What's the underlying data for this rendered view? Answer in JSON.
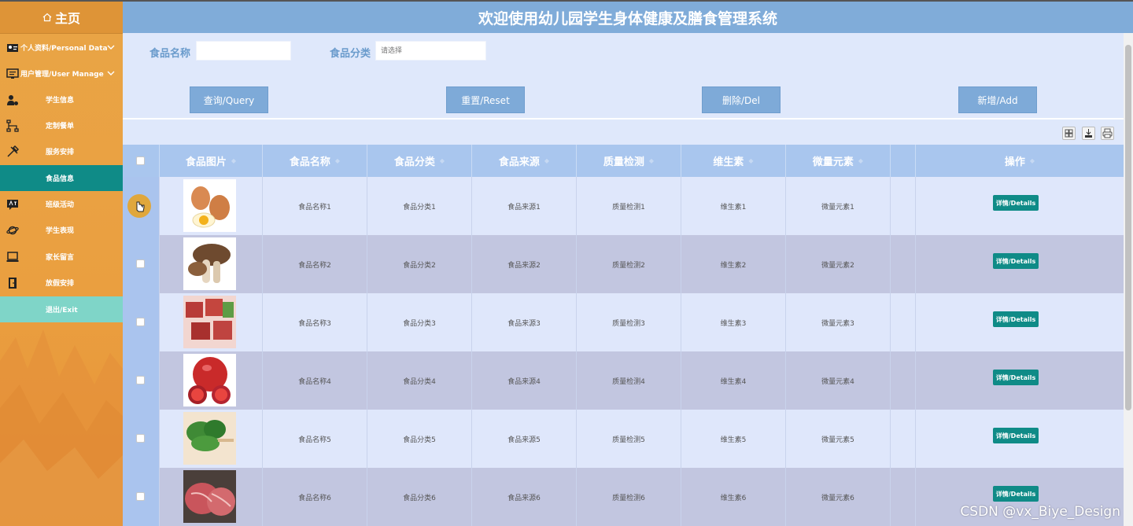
{
  "app": {
    "title": "欢迎使用幼儿园学生身体健康及膳食管理系统",
    "home": "主页"
  },
  "sidebar": {
    "items": [
      {
        "label": "个人资料/Personal Data",
        "icon": "id-card-icon",
        "expandable": true
      },
      {
        "label": "用户管理/User Manage",
        "icon": "monitor-icon",
        "expandable": true
      },
      {
        "label": "学生信息",
        "icon": "user-gear-icon"
      },
      {
        "label": "定制餐单",
        "icon": "sitemap-icon"
      },
      {
        "label": "服务安排",
        "icon": "tools-icon"
      },
      {
        "label": "食品信息",
        "icon": "",
        "active": true
      },
      {
        "label": "班级活动",
        "icon": "translate-icon"
      },
      {
        "label": "学生表现",
        "icon": "planet-icon"
      },
      {
        "label": "家长留言",
        "icon": "laptop-icon"
      },
      {
        "label": "放假安排",
        "icon": "door-icon"
      },
      {
        "label": "退出/Exit",
        "icon": ""
      }
    ]
  },
  "search": {
    "name_label": "食品名称",
    "name_value": "",
    "category_label": "食品分类",
    "category_placeholder": "请选择"
  },
  "buttons": {
    "query": "查询/Query",
    "reset": "重置/Reset",
    "delete": "删除/Del",
    "add": "新增/Add"
  },
  "table": {
    "headers": [
      "食品图片",
      "食品名称",
      "食品分类",
      "食品来源",
      "质量检测",
      "维生素",
      "微量元素",
      "操作"
    ],
    "rows": [
      {
        "image": "eggs",
        "name": "食品名称1",
        "category": "食品分类1",
        "source": "食品来源1",
        "quality": "质量检测1",
        "vitamin": "维生素1",
        "trace": "微量元素1"
      },
      {
        "image": "mushrooms",
        "name": "食品名称2",
        "category": "食品分类2",
        "source": "食品来源2",
        "quality": "质量检测2",
        "vitamin": "维生素2",
        "trace": "微量元素2"
      },
      {
        "image": "beef-cubes",
        "name": "食品名称3",
        "category": "食品分类3",
        "source": "食品来源3",
        "quality": "质量检测3",
        "vitamin": "维生素3",
        "trace": "微量元素3"
      },
      {
        "image": "pomegranate",
        "name": "食品名称4",
        "category": "食品分类4",
        "source": "食品来源4",
        "quality": "质量检测4",
        "vitamin": "维生素4",
        "trace": "微量元素4"
      },
      {
        "image": "spinach",
        "name": "食品名称5",
        "category": "食品分类5",
        "source": "食品来源5",
        "quality": "质量检测5",
        "vitamin": "维生素5",
        "trace": "微量元素5"
      },
      {
        "image": "steak",
        "name": "食品名称6",
        "category": "食品分类6",
        "source": "食品来源6",
        "quality": "质量检测6",
        "vitamin": "维生素6",
        "trace": "微量元素6"
      }
    ],
    "detail_label": "详情/Details"
  },
  "watermark": "CSDN @vx_Biye_Design",
  "colors": {
    "sidebar": "#e9a546",
    "header": "#80acd9",
    "accent": "#0f8b87",
    "button": "#7eaad8"
  }
}
